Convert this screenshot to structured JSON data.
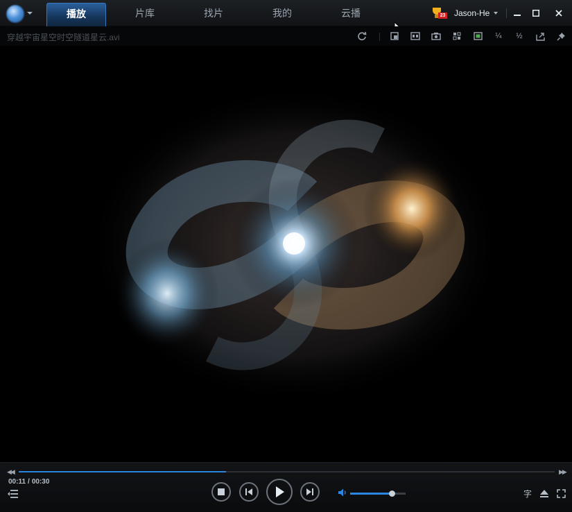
{
  "app": {
    "menu_icon": "player-logo-icon"
  },
  "tabs": [
    {
      "label": "播放",
      "active": true
    },
    {
      "label": "片库",
      "active": false
    },
    {
      "label": "找片",
      "active": false
    },
    {
      "label": "我的",
      "active": false
    },
    {
      "label": "云播",
      "active": false
    }
  ],
  "user": {
    "name": "Jason-He",
    "level_badge": "23",
    "trophy_icon": "trophy-icon"
  },
  "window_controls": [
    "minimize-icon",
    "maximize-icon",
    "close-icon"
  ],
  "file": {
    "name": "穿越宇宙星空时空隧道星云.avi"
  },
  "toolbar": {
    "ratio_quarter": "¼",
    "ratio_half": "½",
    "icons": [
      "refresh-icon",
      "picture-in-picture-icon",
      "subtitle-icon",
      "screenshot-icon",
      "settings-icon",
      "display-icon",
      "external-window-icon",
      "pin-icon"
    ]
  },
  "playback": {
    "current_time": "00:11",
    "separator": "/",
    "total_time": "00:30",
    "progress": 0.3867,
    "volume": 0.75
  },
  "right_controls": {
    "subtitle_label": "字"
  },
  "colors": {
    "accent": "#2a86e0",
    "active_tab": "#1e4d80"
  }
}
